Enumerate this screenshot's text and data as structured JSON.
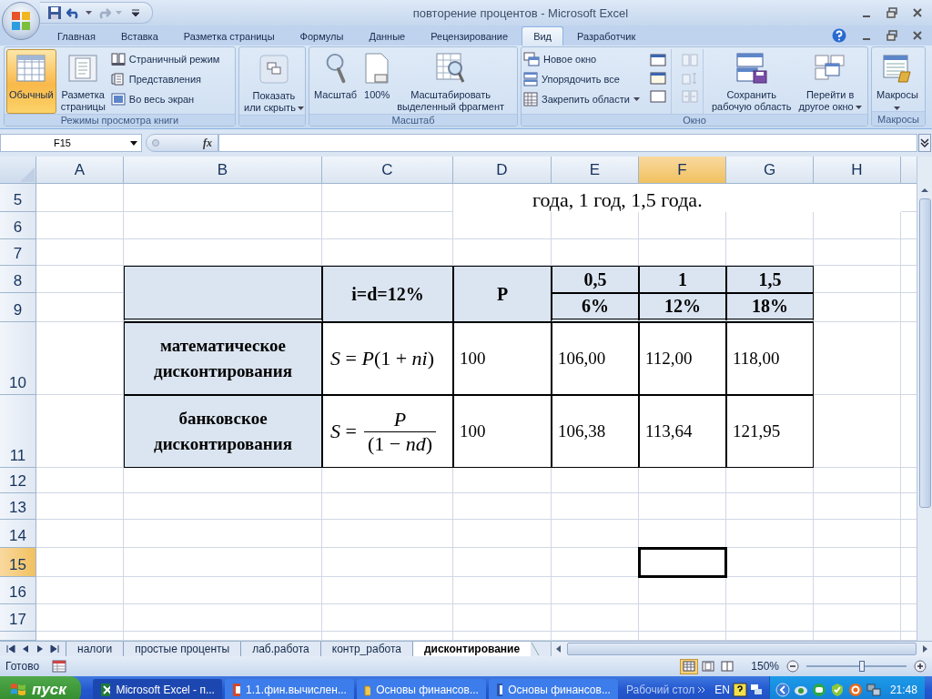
{
  "window": {
    "title": "повторение процентов - Microsoft Excel"
  },
  "ribbon_tabs": [
    {
      "label": "Главная",
      "selected": false
    },
    {
      "label": "Вставка",
      "selected": false
    },
    {
      "label": "Разметка страницы",
      "selected": false
    },
    {
      "label": "Формулы",
      "selected": false
    },
    {
      "label": "Данные",
      "selected": false
    },
    {
      "label": "Рецензирование",
      "selected": false
    },
    {
      "label": "Вид",
      "selected": true
    },
    {
      "label": "Разработчик",
      "selected": false
    }
  ],
  "ribbon_groups": [
    {
      "label": "Режимы просмотра книги",
      "sections": [
        {
          "kind": "large",
          "buttons": [
            {
              "lines": [
                "Обычный"
              ],
              "selected": true,
              "dropdown": false
            },
            {
              "lines": [
                "Разметка",
                "страницы"
              ],
              "selected": false,
              "dropdown": false
            }
          ]
        },
        {
          "kind": "small",
          "buttons": [
            {
              "label": "Страничный режим",
              "dropdown": false
            },
            {
              "label": "Представления",
              "dropdown": false
            },
            {
              "label": "Во весь экран",
              "dropdown": false
            }
          ]
        }
      ]
    },
    {
      "sections": [
        {
          "kind": "large",
          "buttons": [
            {
              "lines": [
                "Показать",
                "или скрыть"
              ],
              "dropdown": true
            }
          ]
        }
      ]
    },
    {
      "label": "Масштаб",
      "sections": [
        {
          "kind": "large",
          "buttons": [
            {
              "lines": [
                "Масштаб"
              ],
              "dropdown": false
            },
            {
              "lines": [
                "100%"
              ],
              "dropdown": false
            },
            {
              "lines": [
                "Масштабировать",
                "выделенный фрагмент"
              ],
              "dropdown": false
            }
          ]
        }
      ]
    },
    {
      "label": "Окно",
      "sections": [
        {
          "kind": "small",
          "buttons": [
            {
              "label": "Новое окно",
              "dropdown": false
            },
            {
              "label": "Упорядочить все",
              "dropdown": false
            },
            {
              "label": "Закрепить области",
              "dropdown": true
            }
          ]
        },
        {
          "kind": "icons",
          "buttons": [
            {
              "disabled": false
            },
            {
              "disabled": false
            },
            {
              "disabled": false
            }
          ]
        },
        {
          "kind": "icons",
          "buttons": [
            {
              "disabled": true
            },
            {
              "disabled": true
            },
            {
              "disabled": true
            }
          ]
        },
        {
          "kind": "large",
          "buttons": [
            {
              "lines": [
                "Сохранить",
                "рабочую область"
              ],
              "dropdown": false
            },
            {
              "lines": [
                "Перейти в",
                "другое окно"
              ],
              "dropdown": true
            }
          ]
        }
      ]
    },
    {
      "label": "Макросы",
      "sections": [
        {
          "kind": "large",
          "buttons": [
            {
              "lines": [
                "Макросы"
              ],
              "dropdown": true
            }
          ]
        }
      ]
    }
  ],
  "formula_bar": {
    "name_box": "F15",
    "function_label": "fx"
  },
  "columns": [
    {
      "label": "A",
      "selected": false
    },
    {
      "label": "B",
      "selected": false
    },
    {
      "label": "C",
      "selected": false
    },
    {
      "label": "D",
      "selected": false
    },
    {
      "label": "E",
      "selected": false
    },
    {
      "label": "F",
      "selected": true
    },
    {
      "label": "G",
      "selected": false
    },
    {
      "label": "H",
      "selected": false
    }
  ],
  "rows": [
    {
      "label": "5",
      "selected": false
    },
    {
      "label": "6",
      "selected": false
    },
    {
      "label": "7",
      "selected": false
    },
    {
      "label": "8",
      "selected": false
    },
    {
      "label": "9",
      "selected": false
    },
    {
      "label": "10",
      "selected": false
    },
    {
      "label": "11",
      "selected": false
    },
    {
      "label": "12",
      "selected": false
    },
    {
      "label": "13",
      "selected": false
    },
    {
      "label": "14",
      "selected": false
    },
    {
      "label": "15",
      "selected": true
    },
    {
      "label": "16",
      "selected": false
    },
    {
      "label": "17",
      "selected": false
    }
  ],
  "caption": "года, 1 год, 1,5 года.",
  "table": {
    "headers": [
      "i=d=12%",
      "P"
    ],
    "periods": [
      {
        "term": "0,5",
        "rate": "6%"
      },
      {
        "term": "1",
        "rate": "12%"
      },
      {
        "term": "1,5",
        "rate": "18%"
      }
    ],
    "rows": [
      {
        "label": "математическое дисконтирования",
        "formula": {
          "kind": "inline",
          "text": "*S* = *P*(1 + *ni*)"
        },
        "values": [
          "100",
          "106,00",
          "112,00",
          "118,00"
        ]
      },
      {
        "label": "банковское дисконтирования",
        "formula": {
          "kind": "fraction",
          "lhs": "*S* =",
          "numerator": "*P*",
          "denominator": "(1 − *nd*)"
        },
        "values": [
          "100",
          "106,38",
          "113,64",
          "121,95"
        ]
      }
    ]
  },
  "sheet_tabs": [
    {
      "label": "налоги",
      "selected": false
    },
    {
      "label": "простые проценты",
      "selected": false
    },
    {
      "label": "лаб.работа",
      "selected": false
    },
    {
      "label": "контр_работа",
      "selected": false
    },
    {
      "label": "дисконтирование",
      "selected": true
    }
  ],
  "status_bar": {
    "status": "Готово",
    "view_buttons": [
      {
        "selected": true
      },
      {
        "selected": false
      },
      {
        "selected": false
      }
    ],
    "zoom": "150%",
    "zoom_slider": {
      "level": 0.55
    }
  },
  "taskbar": {
    "start": "пуск",
    "tasks": [
      {
        "label": "Microsoft Excel - п...",
        "selected": true
      },
      {
        "label": "1.1.фин.вычислен...",
        "selected": false
      },
      {
        "label": "Основы финансов...",
        "selected": false
      },
      {
        "label": "Основы финансов...",
        "selected": false
      }
    ],
    "desktop": "Рабочий стол",
    "language": "EN",
    "clock": "21:48"
  }
}
